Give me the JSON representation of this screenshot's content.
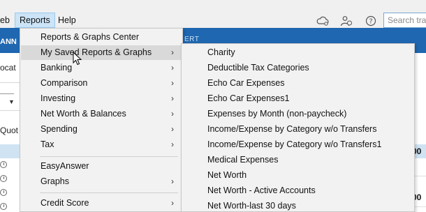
{
  "menubar": {
    "file_cut": "eb",
    "reports": "Reports",
    "help": "Help",
    "search_placeholder": "Search tran"
  },
  "background": {
    "band_left": "ANN",
    "band_right": "ERT",
    "labels": [
      "ocat",
      "Quot"
    ],
    "right_num": "00"
  },
  "reports_menu": {
    "items": [
      {
        "label": "Reports & Graphs Center",
        "submenu": false
      },
      {
        "label": "My Saved Reports & Graphs",
        "submenu": true,
        "highlight": true
      },
      {
        "label": "Banking",
        "submenu": true
      },
      {
        "label": "Comparison",
        "submenu": true
      },
      {
        "label": "Investing",
        "submenu": true
      },
      {
        "label": "Net Worth & Balances",
        "submenu": true
      },
      {
        "label": "Spending",
        "submenu": true
      },
      {
        "label": "Tax",
        "submenu": true
      },
      {
        "label": "EasyAnswer",
        "submenu": false
      },
      {
        "label": "Graphs",
        "submenu": true
      },
      {
        "label": "Credit Score",
        "submenu": true
      }
    ],
    "arrow_glyph": "›"
  },
  "saved_submenu": {
    "items": [
      "Charity",
      "Deductible Tax Categories",
      "Echo Car Expenses",
      "Echo Car Expenses1",
      "Expenses by Month (non-paycheck)",
      "Income/Expense by Category w/o Transfers",
      "Income/Expense by Category w/o Transfers1",
      "Medical Expenses",
      "Net Worth",
      "Net Worth - Active Accounts",
      "Net Worth-last 30 days"
    ]
  },
  "icons": {
    "cloud": "cloud-sync-icon",
    "people": "people-icon",
    "help": "help-icon",
    "cursor": "mouse-cursor-icon"
  },
  "colors": {
    "menubar_bg": "#f0f0f0",
    "menu_bg": "#f2f2f2",
    "highlight": "#d9d9d9",
    "reports_active": "#cce4f7",
    "app_band": "#1f67b0"
  }
}
